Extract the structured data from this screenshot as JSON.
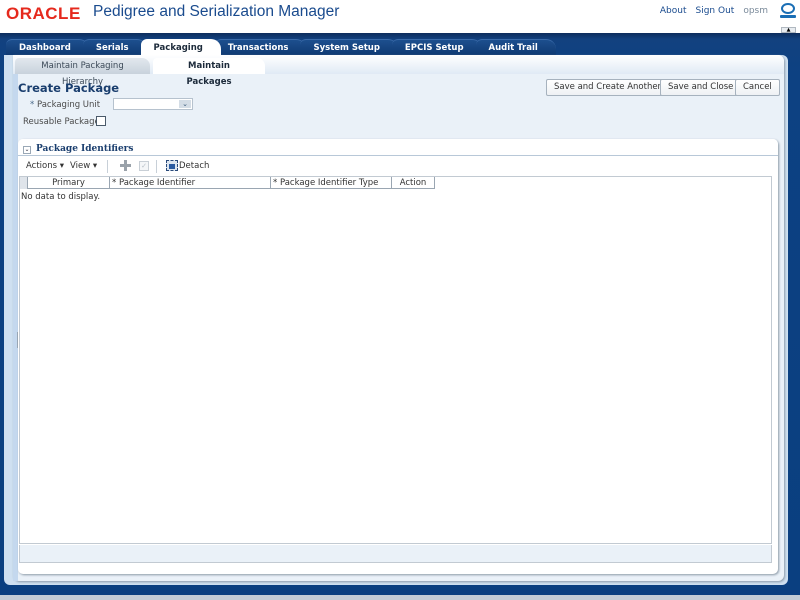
{
  "header": {
    "logo": "ORACLE",
    "app_title": "Pedigree and Serialization Manager",
    "links": {
      "about": "About",
      "sign_out": "Sign Out",
      "user": "opsm"
    }
  },
  "tabs": [
    {
      "label": "Dashboard",
      "active": false
    },
    {
      "label": "Serials",
      "active": false
    },
    {
      "label": "Packaging",
      "active": true
    },
    {
      "label": "Transactions",
      "active": false
    },
    {
      "label": "System Setup",
      "active": false
    },
    {
      "label": "EPCIS Setup",
      "active": false
    },
    {
      "label": "Audit Trail",
      "active": false
    }
  ],
  "subtabs": [
    {
      "label": "Maintain Packaging Hierarchy",
      "active": false
    },
    {
      "label": "Maintain Packages",
      "active": true
    }
  ],
  "page": {
    "title": "Create Package",
    "fields": {
      "packaging_unit_label": "Packaging Unit",
      "packaging_unit_required": "*",
      "packaging_unit_value": "",
      "reusable_label": "Reusable Package",
      "reusable_checked": false
    },
    "buttons": {
      "save_create_another": "Save and Create Another",
      "save_close": "Save and Close",
      "cancel": "Cancel"
    }
  },
  "panel": {
    "title": "Package Identifiers",
    "toolbar": {
      "actions": "Actions",
      "view": "View",
      "detach": "Detach"
    },
    "table": {
      "columns": [
        "Primary",
        "* Package Identifier",
        "* Package Identifier Type",
        "Action"
      ],
      "rows": [],
      "empty_text": "No data to display."
    }
  }
}
